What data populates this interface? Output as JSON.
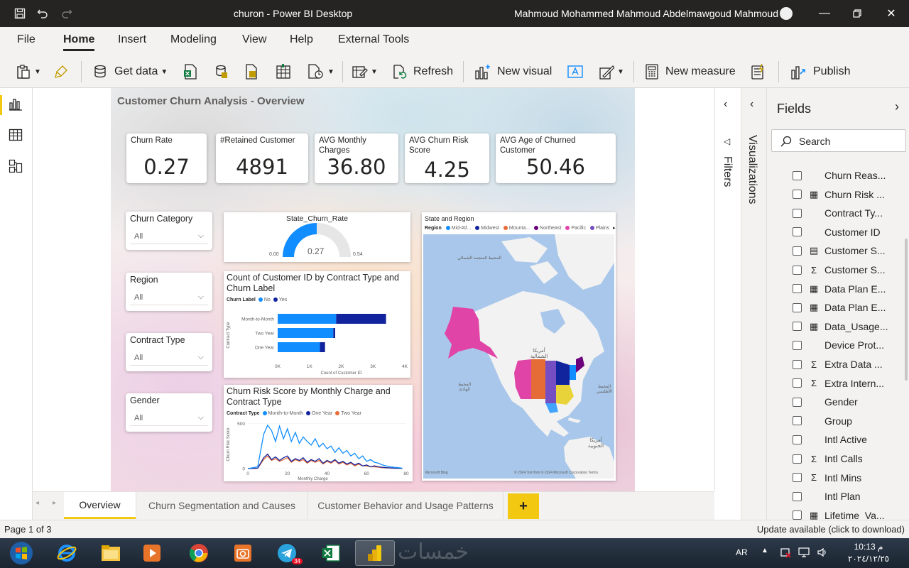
{
  "app": {
    "title": "churon - Power BI Desktop",
    "user": "Mahmoud Mohammed Mahmoud Abdelmawgoud Mahmoud"
  },
  "menu": [
    "File",
    "Home",
    "Insert",
    "Modeling",
    "View",
    "Help",
    "External Tools"
  ],
  "ribbon": {
    "get_data": "Get data",
    "refresh": "Refresh",
    "new_visual": "New visual",
    "new_measure": "New measure",
    "publish": "Publish"
  },
  "report": {
    "title": "Customer Churn Analysis - Overview",
    "cards": [
      {
        "label": "Churn Rate",
        "value": "0.27"
      },
      {
        "label": "#Retained Customer",
        "value": "4891"
      },
      {
        "label": "AVG Monthly Charges",
        "value": "36.80"
      },
      {
        "label": "AVG Churn Risk Score",
        "value": "4.25"
      },
      {
        "label": "AVG Age of Churned Customer",
        "value": "50.46"
      }
    ],
    "slicers": [
      {
        "label": "Churn Category",
        "value": "All"
      },
      {
        "label": "Region",
        "value": "All"
      },
      {
        "label": "Contract Type",
        "value": "All"
      },
      {
        "label": "Gender",
        "value": "All"
      }
    ],
    "gauge": {
      "title": "State_Churn_Rate",
      "value": 0.27,
      "value_label": "0.27",
      "min_label": "0.00",
      "max_label": "0.54",
      "fill_fraction": 0.5,
      "color": "#118DFF"
    },
    "map": {
      "title": "State and Region",
      "legend_title": "Region",
      "legend": [
        {
          "name": "Mid-Atl...",
          "color": "#118DFF"
        },
        {
          "name": "Midwest",
          "color": "#12239E"
        },
        {
          "name": "Mounta...",
          "color": "#E66C37"
        },
        {
          "name": "Northeast",
          "color": "#6B007B"
        },
        {
          "name": "Pacific",
          "color": "#E044A7"
        },
        {
          "name": "Plains",
          "color": "#744EC2"
        }
      ],
      "labels": [
        "المحيط المتجمد الشمالي",
        "أمريكا الشمالية",
        "المحيط الهادئ",
        "المحيط الأطلسي",
        "أمريكا الجنوبية"
      ],
      "attribution": "© 2024 TomTom © 2024 Microsoft Corporation Terms",
      "logo": "Microsoft Bing"
    }
  },
  "chart_data": [
    {
      "type": "bar",
      "title": "Count of Customer ID by Contract Type and Churn Label",
      "legend_title": "Churn Label",
      "categories": [
        "Month-to-Month",
        "Two Year",
        "One Year"
      ],
      "series": [
        {
          "name": "No",
          "color": "#118DFF",
          "values": [
            1840,
            1750,
            1330
          ]
        },
        {
          "name": "Yes",
          "color": "#12239E",
          "values": [
            1570,
            60,
            160
          ]
        }
      ],
      "stacked": true,
      "orientation": "horizontal",
      "xlabel": "Count of Customer ID",
      "ylabel": "Contract Type",
      "xticks": [
        "0K",
        "1K",
        "2K",
        "3K",
        "4K"
      ],
      "xlim": [
        0,
        4000
      ]
    },
    {
      "type": "line",
      "title": "Churn Risk Score by Monthly Charge and Contract Type",
      "legend_title": "Contract Type",
      "x": [
        0,
        5,
        8,
        10,
        12,
        14,
        16,
        18,
        20,
        22,
        24,
        26,
        28,
        30,
        32,
        34,
        36,
        38,
        40,
        42,
        44,
        46,
        48,
        50,
        52,
        54,
        56,
        58,
        60,
        62,
        64,
        66,
        68,
        70,
        72,
        74,
        76,
        78
      ],
      "series": [
        {
          "name": "Month-to-Month",
          "color": "#118DFF",
          "values": [
            0,
            20,
            380,
            480,
            420,
            300,
            470,
            330,
            440,
            300,
            400,
            280,
            350,
            300,
            260,
            330,
            240,
            280,
            220,
            250,
            180,
            230,
            170,
            200,
            140,
            170,
            110,
            140,
            80,
            100,
            70,
            60,
            40,
            30,
            20,
            15,
            10,
            5
          ]
        },
        {
          "name": "One Year",
          "color": "#12239E",
          "values": [
            0,
            5,
            120,
            160,
            100,
            130,
            90,
            120,
            140,
            80,
            110,
            90,
            120,
            70,
            100,
            80,
            110,
            60,
            90,
            70,
            100,
            60,
            80,
            50,
            70,
            40,
            60,
            30,
            40,
            20,
            30,
            20,
            15,
            10,
            8,
            5,
            4,
            2
          ]
        },
        {
          "name": "Two Year",
          "color": "#E66C37",
          "values": [
            0,
            5,
            100,
            140,
            90,
            110,
            80,
            100,
            120,
            70,
            100,
            80,
            100,
            60,
            90,
            70,
            90,
            50,
            80,
            60,
            90,
            50,
            70,
            40,
            60,
            30,
            50,
            30,
            30,
            20,
            20,
            15,
            10,
            8,
            6,
            4,
            3,
            2
          ]
        }
      ],
      "xlabel": "Monthly Charge",
      "ylabel": "Churn Risk Score",
      "xticks": [
        "0",
        "20",
        "40",
        "60",
        "80"
      ],
      "yticks": [
        "0",
        "500"
      ],
      "xlim": [
        0,
        80
      ],
      "ylim": [
        0,
        550
      ]
    }
  ],
  "filters_label": "Filters",
  "visualizations_label": "Visualizations",
  "fields_panel": {
    "title": "Fields",
    "search_placeholder": "Search",
    "items": [
      {
        "name": "Churn Reas...",
        "type": ""
      },
      {
        "name": "Churn Risk ...",
        "type": "table"
      },
      {
        "name": "Contract Ty...",
        "type": ""
      },
      {
        "name": "Customer ID",
        "type": ""
      },
      {
        "name": "Customer S...",
        "type": "hierarchy"
      },
      {
        "name": "Customer S...",
        "type": "sigma"
      },
      {
        "name": "Data Plan E...",
        "type": "table"
      },
      {
        "name": "Data Plan E...",
        "type": "table"
      },
      {
        "name": "Data_Usage...",
        "type": "table"
      },
      {
        "name": "Device Prot...",
        "type": ""
      },
      {
        "name": "Extra Data ...",
        "type": "sigma"
      },
      {
        "name": "Extra Intern...",
        "type": "sigma"
      },
      {
        "name": "Gender",
        "type": ""
      },
      {
        "name": "Group",
        "type": ""
      },
      {
        "name": "Intl Active",
        "type": ""
      },
      {
        "name": "Intl Calls",
        "type": "sigma"
      },
      {
        "name": "Intl Mins",
        "type": "sigma"
      },
      {
        "name": "Intl Plan",
        "type": ""
      },
      {
        "name": "Lifetime_Va...",
        "type": "table"
      }
    ]
  },
  "pages": [
    {
      "label": "Overview",
      "active": true
    },
    {
      "label": "Churn Segmentation and Causes",
      "active": false
    },
    {
      "label": "Customer Behavior and Usage Patterns",
      "active": false
    }
  ],
  "add_page": "+",
  "status": {
    "page": "Page 1 of 3",
    "update": "Update available (click to download)"
  },
  "taskbar": {
    "lang": "AR",
    "time": "10:13 م",
    "date": "٢٠٢٤/١٢/٢٥",
    "telegram_badge": "34",
    "watermark": "خمسات"
  }
}
